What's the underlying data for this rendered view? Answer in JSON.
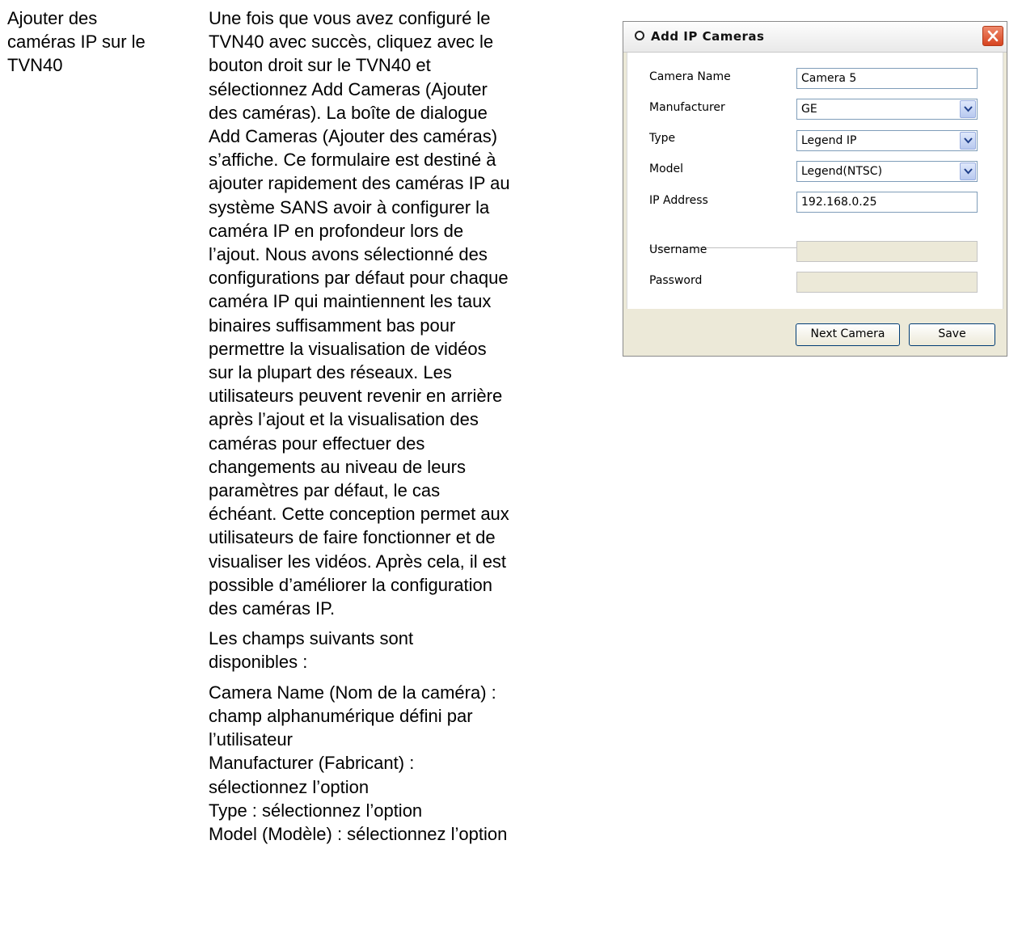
{
  "document": {
    "side_heading": [
      "Ajouter des",
      "caméras IP sur le",
      "TVN40"
    ],
    "paragraph1": [
      "Une fois que vous avez configuré le",
      "TVN40 avec succès, cliquez avec le",
      "bouton droit sur le TVN40 et",
      "sélectionnez Add Cameras (Ajouter",
      "des caméras). La boîte de dialogue",
      "Add Cameras (Ajouter des caméras)",
      "s’affiche. Ce formulaire est destiné à",
      "ajouter rapidement des caméras IP au",
      "système SANS avoir à configurer la",
      "caméra IP en profondeur lors de",
      "l’ajout. Nous avons sélectionné des",
      "configurations par défaut pour chaque",
      "caméra IP qui maintiennent les taux",
      "binaires suffisamment bas pour",
      "permettre la visualisation de vidéos",
      "sur la plupart des réseaux. Les",
      "utilisateurs peuvent revenir en arrière",
      "après l’ajout et la visualisation des",
      "caméras pour effectuer des",
      "changements au niveau de leurs",
      "paramètres par défaut, le cas",
      "échéant. Cette conception permet aux",
      "utilisateurs de faire fonctionner et de",
      "visualiser les vidéos. Après cela, il est",
      "possible d’améliorer la configuration",
      "des caméras IP."
    ],
    "paragraph2": [
      "Les champs suivants sont",
      "disponibles :"
    ],
    "paragraph3": [
      "Camera Name (Nom de la caméra) :",
      "champ alphanumérique défini par",
      "l’utilisateur",
      "Manufacturer (Fabricant) :",
      "sélectionnez l’option",
      "Type : sélectionnez l’option",
      "Model (Modèle) : sélectionnez l’option"
    ]
  },
  "dialog": {
    "title": "Add IP Cameras",
    "labels": {
      "camera_name": "Camera Name",
      "manufacturer": "Manufacturer",
      "type": "Type",
      "model": "Model",
      "ip_address": "IP Address",
      "username": "Username",
      "password": "Password"
    },
    "values": {
      "camera_name": "Camera 5",
      "manufacturer": "GE",
      "type": "Legend IP",
      "model": "Legend(NTSC)",
      "ip_address": "192.168.0.25",
      "username": "",
      "password": ""
    },
    "buttons": {
      "next": "Next Camera",
      "save": "Save"
    },
    "colors": {
      "title_bar": "#f4f4f4",
      "close_button": "#d6431f",
      "window_frame": "#ece9d8",
      "input_border": "#7f9db9"
    }
  }
}
